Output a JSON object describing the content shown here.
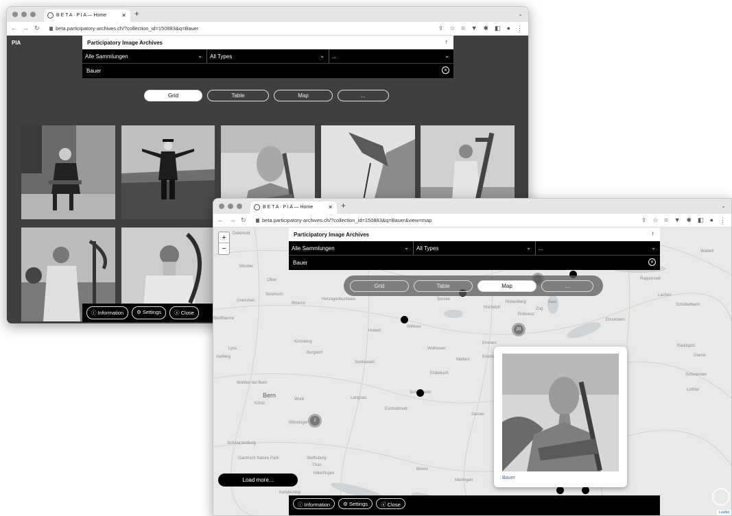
{
  "window1": {
    "tab_title": "B E T A · P I A — Home",
    "url": "beta.participatory-archives.ch/?collection_id=150883&q=Bauer",
    "logo": "PIA",
    "panel_title": "Participatory Image Archives",
    "filter_collection": "Alle Sammlungen",
    "filter_type": "All Types",
    "filter_more": "...",
    "search_value": "Bauer",
    "views": [
      "Grid",
      "Table",
      "Map",
      "..."
    ],
    "active_view": "Grid",
    "footer": [
      "ⓘ Information",
      "⚙ Settings",
      "ⓧ Close"
    ]
  },
  "window2": {
    "tab_title": "B E T A · P I A — Home",
    "url": "beta.participatory-archives.ch/?collection_id=150883&q=Bauer&view=map",
    "panel_title": "Participatory Image Archives",
    "filter_collection": "Alle Sammlungen",
    "filter_type": "All Types",
    "filter_more": "...",
    "search_value": "Bauer",
    "views": [
      "Grid",
      "Table",
      "Map",
      "..."
    ],
    "active_view": "Map",
    "zoom_in": "+",
    "zoom_out": "−",
    "cluster_labels": [
      "20",
      "2"
    ],
    "popup_caption": "Bauer",
    "load_more": "Load more...",
    "footer": [
      "ⓘ Information",
      "⚙ Settings",
      "ⓧ Close"
    ],
    "attribution": "Leaflet",
    "places": [
      "Delémont",
      "Moutier",
      "Olten",
      "Solothurn",
      "Grenchen",
      "Biberist",
      "Herzogenbuchsee",
      "Sursee",
      "Willisau",
      "Huttwil",
      "Hochdorf",
      "Emmen",
      "Kriens",
      "Lyss",
      "Aarberg",
      "Kirchberg",
      "Burgdorf",
      "Sumiswald",
      "Wolhusen",
      "Malters",
      "Entlebuch",
      "Wohlen bei Bern",
      "Bern",
      "Köniz",
      "Worb",
      "Langnau",
      "Escholzmatt",
      "Schüpfheim",
      "Sarnen",
      "Münsingen",
      "Schwarzenburg",
      "Steffisburg",
      "Thun",
      "Hilterfingen",
      "Brienz",
      "Meiringen",
      "Einsiedeln",
      "Rapperswil",
      "Lachen",
      "Schübelbach",
      "Wattwil",
      "Glarus",
      "Schwanden",
      "Linthal",
      "Rautispitz",
      "Baar",
      "Zug",
      "Hünenberg",
      "Rotkreuz",
      "Gantrisch Nature Park",
      "Biel/Bienne",
      "Kandersteg"
    ]
  }
}
